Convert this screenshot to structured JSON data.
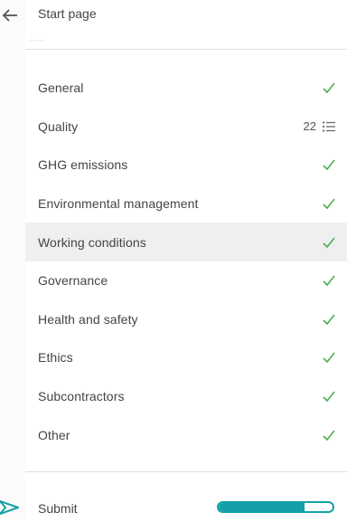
{
  "header": {
    "back_icon": "arrow-left-icon",
    "start_label": "Start page"
  },
  "menu": {
    "items": [
      {
        "label": "General",
        "status": "complete",
        "icon": "check-icon",
        "selected": false
      },
      {
        "label": "Quality",
        "status": "count",
        "count": "22",
        "icon": "list-icon",
        "selected": false
      },
      {
        "label": "GHG emissions",
        "status": "complete",
        "icon": "check-icon",
        "selected": false
      },
      {
        "label": "Environmental management",
        "status": "complete",
        "icon": "check-icon",
        "selected": false
      },
      {
        "label": "Working conditions",
        "status": "complete",
        "icon": "check-icon",
        "selected": true
      },
      {
        "label": "Governance",
        "status": "complete",
        "icon": "check-icon",
        "selected": false
      },
      {
        "label": "Health and safety",
        "status": "complete",
        "icon": "check-icon",
        "selected": false
      },
      {
        "label": "Ethics",
        "status": "complete",
        "icon": "check-icon",
        "selected": false
      },
      {
        "label": "Subcontractors",
        "status": "complete",
        "icon": "check-icon",
        "selected": false
      },
      {
        "label": "Other",
        "status": "complete",
        "icon": "check-icon",
        "selected": false
      }
    ]
  },
  "submit": {
    "label": "Submit",
    "icon": "send-arrow-icon",
    "progress_percent": 75
  },
  "colors": {
    "check": "#4caf50",
    "accent": "#14a0a8",
    "selected_bg": "#efefef"
  }
}
